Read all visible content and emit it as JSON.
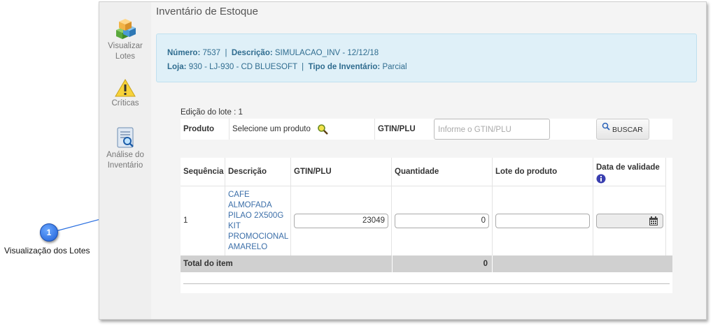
{
  "sidebar": {
    "items": [
      {
        "label_line1": "Visualizar",
        "label_line2": "Lotes"
      },
      {
        "label_line1": "Críticas",
        "label_line2": ""
      },
      {
        "label_line1": "Análise do",
        "label_line2": "Inventário"
      }
    ]
  },
  "header": {
    "title": "Inventário de Estoque"
  },
  "info": {
    "numero_label": "Número:",
    "numero_value": "7537",
    "descricao_label": "Descrição:",
    "descricao_value": "SIMULACAO_INV - 12/12/18",
    "loja_label": "Loja:",
    "loja_value": "930 - LJ-930 - CD BLUESOFT",
    "tipo_label": "Tipo de Inventário:",
    "tipo_value": "Parcial",
    "separator": "|"
  },
  "edicao": {
    "label": "Edição do lote : 1"
  },
  "search": {
    "produto_label": "Produto",
    "produto_value": "Selecione um produto",
    "gtin_label": "GTIN/PLU",
    "gtin_placeholder": "Informe o GTIN/PLU",
    "buscar_label": "BUSCAR"
  },
  "table": {
    "headers": {
      "sequencia": "Sequência",
      "descricao": "Descrição",
      "gtin": "GTIN/PLU",
      "quantidade": "Quantidade",
      "lote": "Lote do produto",
      "validade": "Data de validade"
    },
    "row": {
      "sequencia": "1",
      "descricao_lines": [
        "CAFE",
        "ALMOFADA",
        "PILAO 2X500G",
        "KIT",
        "PROMOCIONAL",
        "AMARELO"
      ],
      "gtin": "23049",
      "quantidade": "0",
      "lote": ""
    },
    "total": {
      "label": "Total do item",
      "quantidade": "0"
    }
  },
  "callout": {
    "number": "1",
    "label": "Visualização dos Lotes"
  },
  "colors": {
    "info_bg": "#dff0f8",
    "link": "#3b6ea8",
    "callout": "#1f5fd6"
  }
}
